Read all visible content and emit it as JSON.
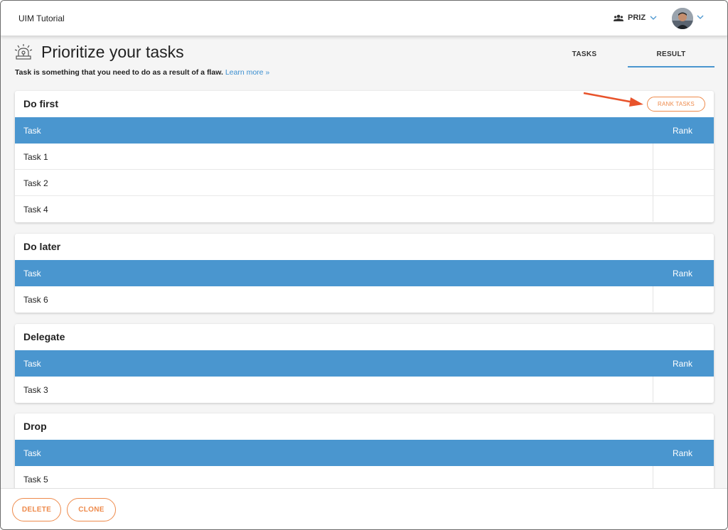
{
  "app": {
    "title": "UIM Tutorial"
  },
  "header": {
    "team_label": "PRIZ"
  },
  "page": {
    "title": "Prioritize your tasks",
    "description": "Task is something that you need to do as a result of a flaw.",
    "learn_more": "Learn more »",
    "tabs": [
      {
        "label": "TASKS",
        "active": false
      },
      {
        "label": "RESULT",
        "active": true
      }
    ]
  },
  "rank_button_label": "RANK TASKS",
  "columns": {
    "task": "Task",
    "rank": "Rank"
  },
  "groups": [
    {
      "title": "Do first",
      "rows": [
        {
          "task": "Task 1",
          "rank": ""
        },
        {
          "task": "Task 2",
          "rank": ""
        },
        {
          "task": "Task 4",
          "rank": ""
        }
      ]
    },
    {
      "title": "Do later",
      "rows": [
        {
          "task": "Task 6",
          "rank": ""
        }
      ]
    },
    {
      "title": "Delegate",
      "rows": [
        {
          "task": "Task 3",
          "rank": ""
        }
      ]
    },
    {
      "title": "Drop",
      "rows": [
        {
          "task": "Task 5",
          "rank": ""
        }
      ]
    }
  ],
  "footer": {
    "delete_label": "DELETE",
    "clone_label": "CLONE"
  },
  "colors": {
    "accent": "#4a96cf",
    "orange": "#ee8a4b",
    "arrow": "#e8532b"
  }
}
